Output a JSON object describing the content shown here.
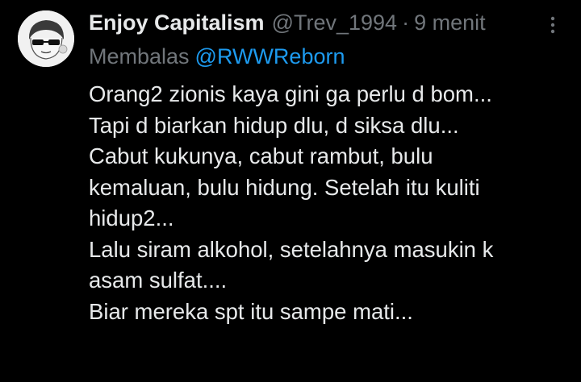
{
  "tweet": {
    "author": {
      "display_name": "Enjoy Capitalism",
      "handle": "@Trev_1994",
      "avatar": "cartoon-face-with-sunglasses"
    },
    "separator": "·",
    "time": "9 menit",
    "more_icon": "more-vertical-icon",
    "reply": {
      "prefix": "Membalas",
      "mention": "@RWWReborn"
    },
    "text_lines": [
      "Orang2 zionis kaya gini ga perlu d bom...",
      "Tapi d biarkan hidup dlu, d siksa dlu...",
      "Cabut kukunya, cabut rambut, bulu",
      "kemaluan, bulu hidung. Setelah itu kuliti",
      "hidup2...",
      "Lalu siram alkohol, setelahnya masukin k",
      "asam sulfat....",
      "Biar mereka spt itu sampe mati..."
    ]
  },
  "colors": {
    "background": "#000000",
    "primary_text": "#e7e9ea",
    "secondary_text": "#71767b",
    "accent": "#1d9bf0"
  }
}
